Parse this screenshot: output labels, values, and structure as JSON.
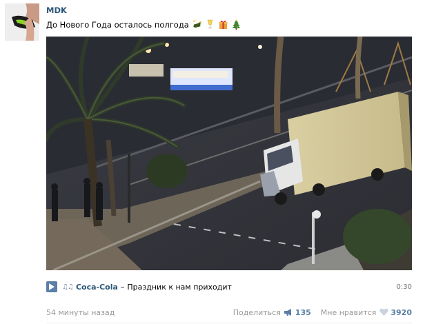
{
  "post": {
    "author": "MDK",
    "text": "До Нового Года осталось полгода",
    "emojis": [
      "champagne-bottle-icon",
      "champagne-glass-icon",
      "gift-icon",
      "christmas-tree-icon"
    ]
  },
  "audio": {
    "artist": "Coca-Cola",
    "dash": "–",
    "title": "Праздник к нам приходит",
    "duration": "0:30"
  },
  "footer": {
    "timestamp": "54 минуты назад",
    "share_label": "Поделиться",
    "share_count": "135",
    "like_label": "Мне нравится",
    "like_count": "3920"
  },
  "colors": {
    "link": "#2b587a",
    "accent": "#5b7fa6",
    "muted": "#999999"
  }
}
